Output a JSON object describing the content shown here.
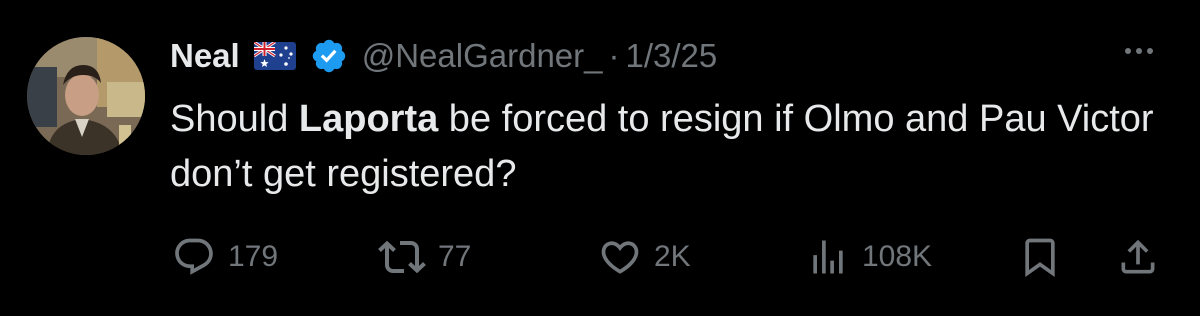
{
  "tweet": {
    "author_name": "Neal",
    "handle": "@NealGardner_",
    "separator": "·",
    "date": "1/3/25",
    "text_part1": "Should ",
    "text_bold": "Laporta",
    "text_part2": " be forced to resign if Olmo and Pau Victor don’t get registered?",
    "stats": {
      "replies": "179",
      "reposts": "77",
      "likes": "2K",
      "views": "108K"
    }
  },
  "icons": {
    "flag": "australia-flag-icon",
    "verified": "verified-badge-icon",
    "more": "more-icon",
    "reply": "reply-icon",
    "repost": "repost-icon",
    "like": "heart-icon",
    "views": "views-chart-icon",
    "bookmark": "bookmark-icon",
    "share": "share-icon"
  },
  "colors": {
    "background": "#000000",
    "text": "#e7e9ea",
    "muted": "#71767b",
    "verified": "#1d9bf0"
  }
}
